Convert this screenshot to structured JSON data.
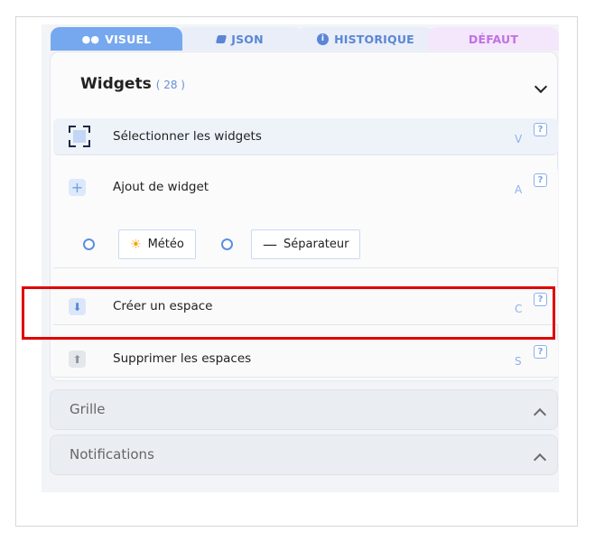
{
  "tabs": [
    {
      "label": "VISUEL",
      "icon": "eye-icon",
      "glyph": "●●"
    },
    {
      "label": "JSON",
      "icon": "json-icon"
    },
    {
      "label": "HISTORIQUE",
      "icon": "info-icon",
      "glyph": "i"
    },
    {
      "label": "DÉFAUT"
    }
  ],
  "widgets": {
    "title": "Widgets",
    "count": "( 28 )",
    "rows": [
      {
        "label": "Sélectionner les widgets",
        "key": "V",
        "help": "?"
      },
      {
        "label": "Ajout de widget",
        "key": "A",
        "help": "?",
        "icon_glyph": "+"
      },
      {
        "label": "Créer un espace",
        "key": "C",
        "help": "?",
        "icon_glyph": "⬇"
      },
      {
        "label": "Supprimer les espaces",
        "key": "S",
        "help": "?",
        "icon_glyph": "⬆"
      }
    ],
    "options": [
      {
        "label": "Météo",
        "icon": "sun-icon",
        "glyph": "☀"
      },
      {
        "label": "Séparateur",
        "icon": "dash-icon",
        "glyph": "—"
      }
    ]
  },
  "sections": [
    {
      "title": "Grille"
    },
    {
      "title": "Notifications"
    }
  ],
  "colors": {
    "accent": "#76a8ef",
    "highlight": "#e00000",
    "default_tab": "#c071e2"
  }
}
